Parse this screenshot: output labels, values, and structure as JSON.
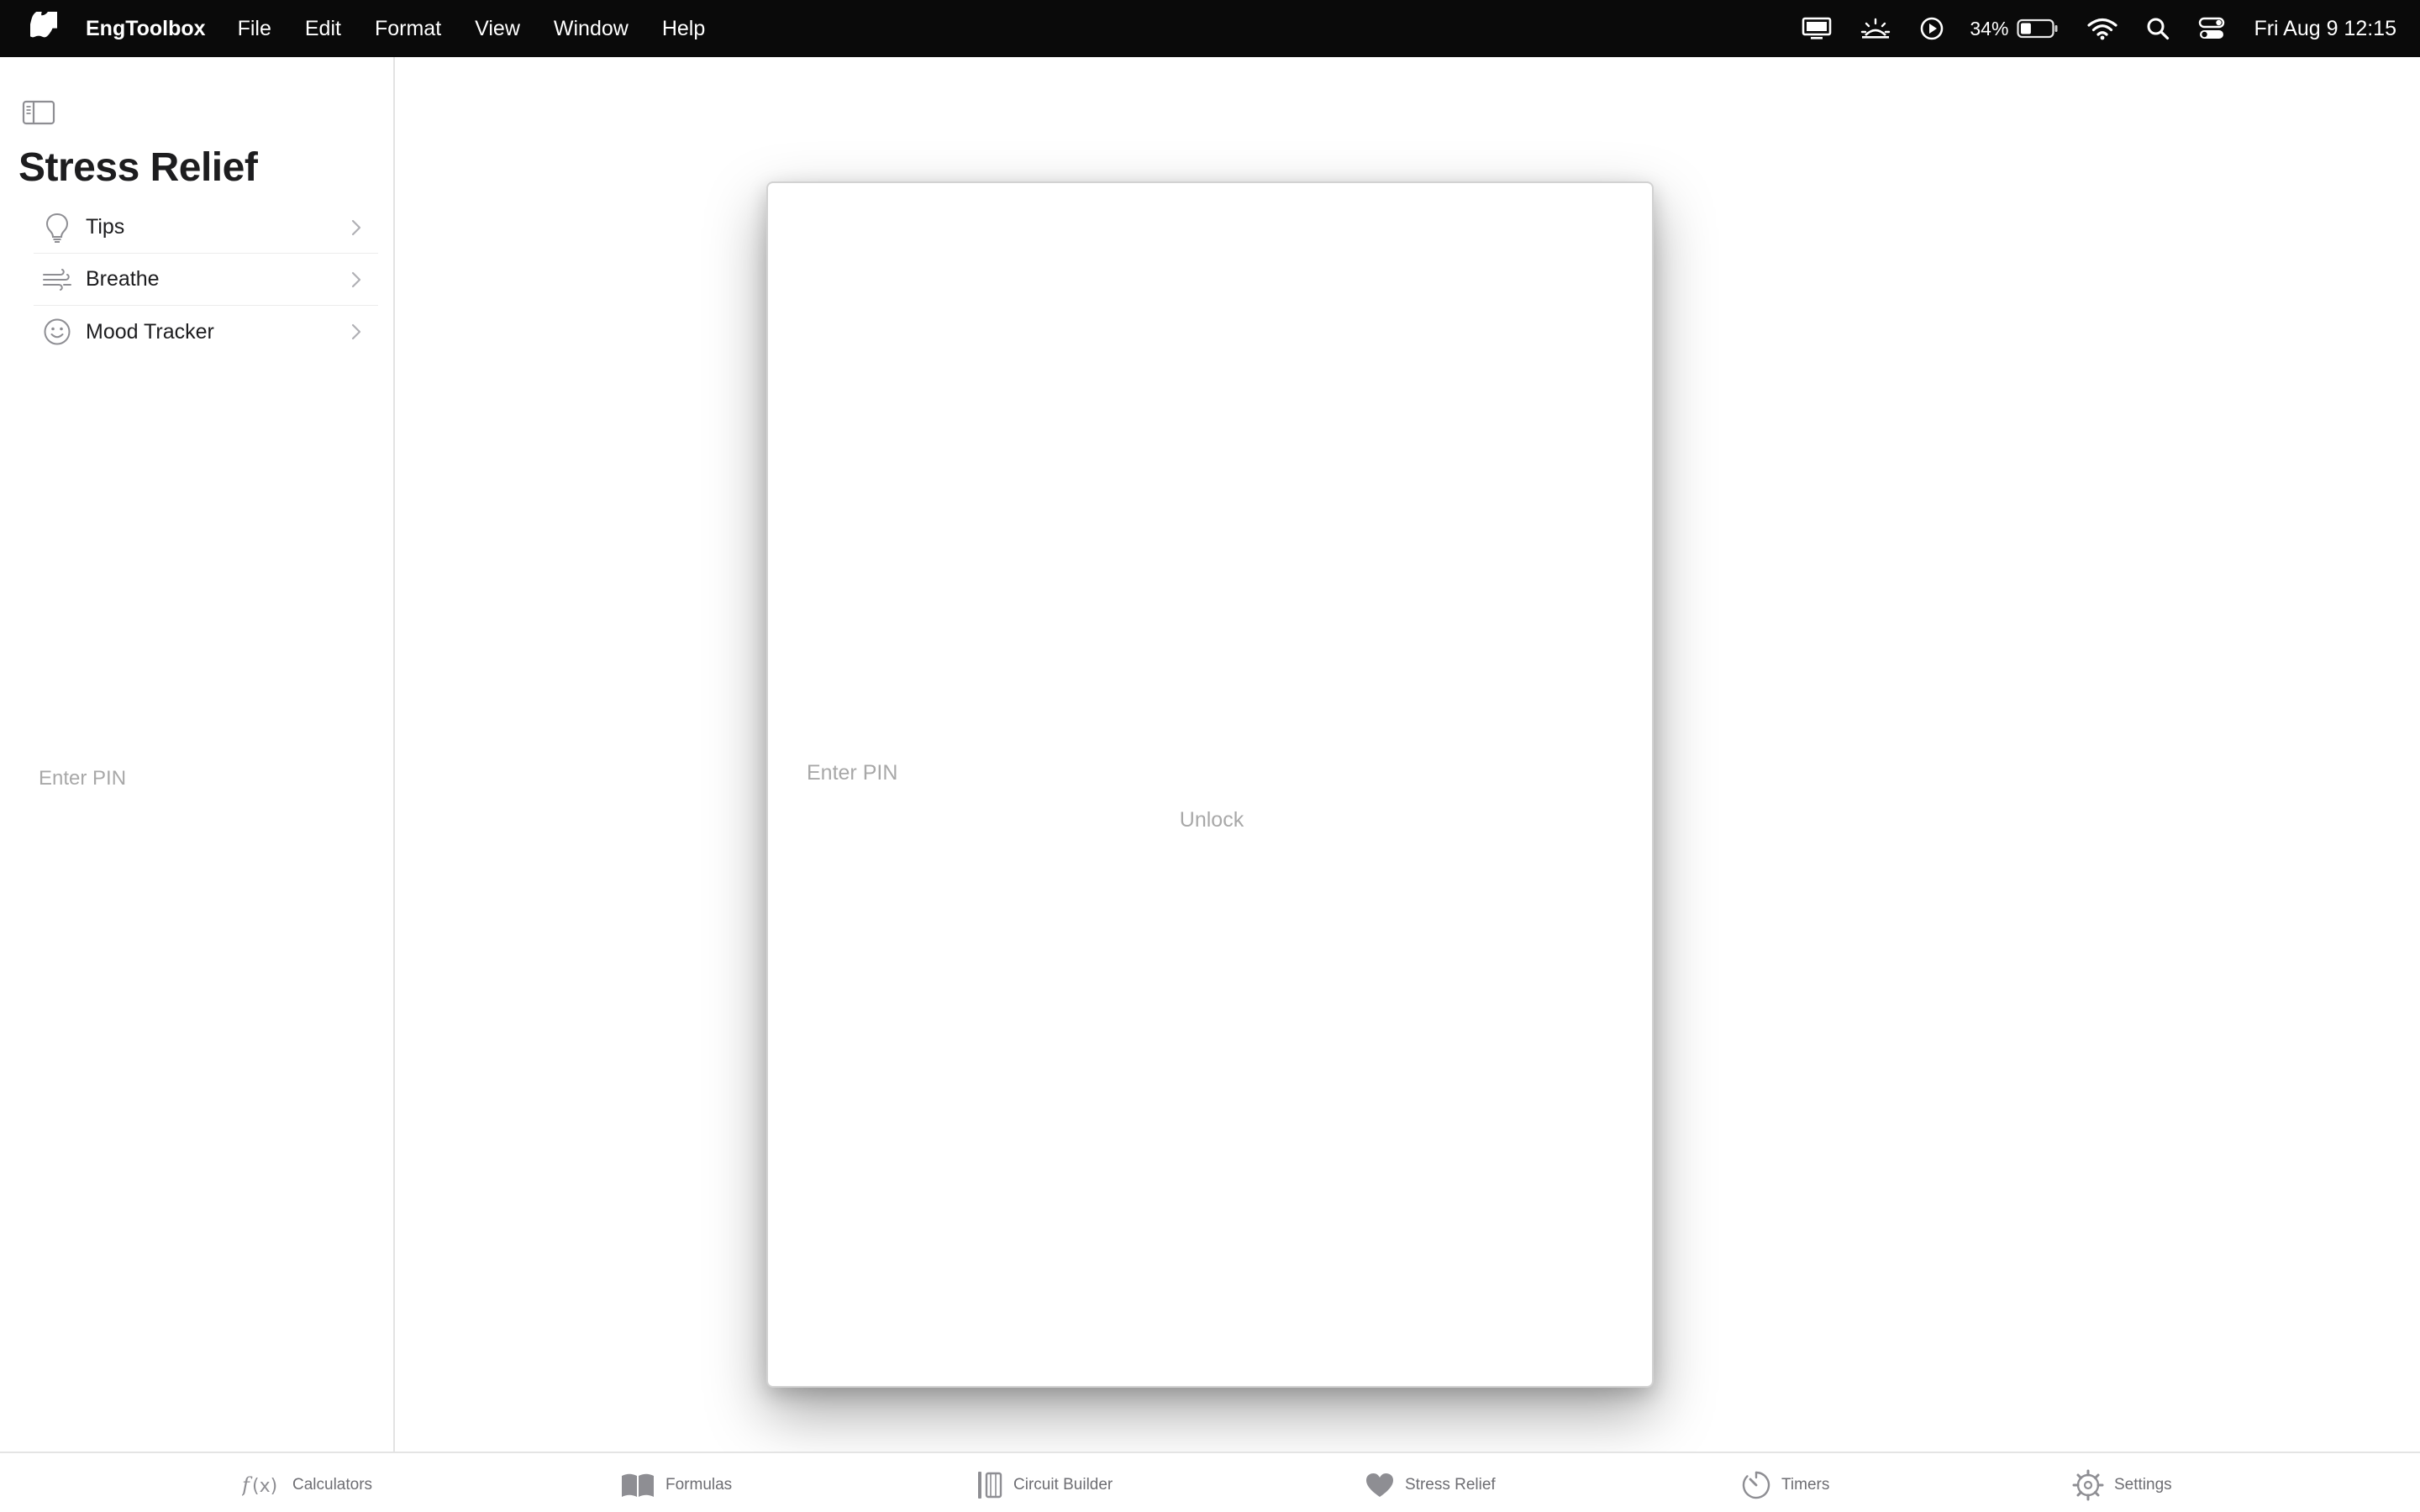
{
  "menubar": {
    "app_name": "EngToolbox",
    "menus": [
      "File",
      "Edit",
      "Format",
      "View",
      "Window",
      "Help"
    ],
    "battery_percent": "34%",
    "battery_level": 0.34,
    "clock": "Fri Aug 9  12:15"
  },
  "sidebar": {
    "title": "Stress Relief",
    "items": [
      {
        "label": "Tips",
        "icon": "lightbulb-icon"
      },
      {
        "label": "Breathe",
        "icon": "wind-icon"
      },
      {
        "label": "Mood Tracker",
        "icon": "smiley-icon"
      }
    ],
    "pin_hint": "Enter PIN"
  },
  "dialog": {
    "pin_placeholder": "Enter PIN",
    "unlock_label": "Unlock"
  },
  "tabbar": {
    "active": "Stress Relief",
    "tabs": [
      {
        "label": "Calculators",
        "icon": "function-icon"
      },
      {
        "label": "Formulas",
        "icon": "book-icon"
      },
      {
        "label": "Circuit Builder",
        "icon": "circuit-icon"
      },
      {
        "label": "Stress Relief",
        "icon": "heart-icon"
      },
      {
        "label": "Timers",
        "icon": "timer-icon"
      },
      {
        "label": "Settings",
        "icon": "gear-icon"
      }
    ]
  }
}
